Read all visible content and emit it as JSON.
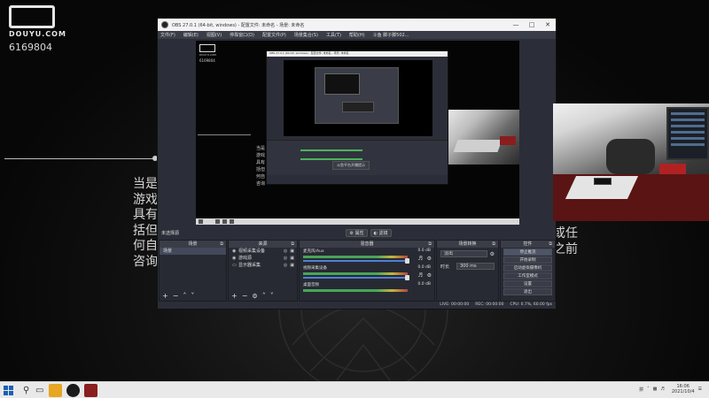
{
  "background": {
    "brand": "DOUYU.COM",
    "room_id": "6169804",
    "text_left": [
      "当是",
      "游戏",
      "具有",
      "括但",
      "何自",
      "咨询"
    ],
    "text_right": [
      "或任",
      "之前"
    ]
  },
  "obs": {
    "title": "OBS 27.0.1 (64-bit, windows) - 配置文件: 未命名 - 场景: 未命名",
    "menu": [
      "文件(F)",
      "编辑(E)",
      "视图(V)",
      "停靠窗口(D)",
      "配置文件(P)",
      "场景集合(S)",
      "工具(T)",
      "帮助(H)",
      "斗鱼 脚子脚502..."
    ],
    "preview_brand": "DOUYU.COM",
    "preview_room": "6169804",
    "preview_text": [
      "当是",
      "游戏",
      "具有",
      "括但",
      "何自",
      "咨询"
    ],
    "nested_popup": "斗鱼平台开播提示",
    "subbar": {
      "scene_label": "未选择源",
      "props": "属性",
      "filters": "滤镜"
    },
    "docks": {
      "scenes": {
        "title": "场景",
        "items": [
          "场景"
        ]
      },
      "sources": {
        "title": "来源",
        "items": [
          {
            "icon": "camera-icon",
            "label": "视频采集设备"
          },
          {
            "icon": "gamepad-icon",
            "label": "游戏源"
          },
          {
            "icon": "monitor-icon",
            "label": "显示器采集"
          }
        ]
      },
      "mixer": {
        "title": "混音器",
        "channels": [
          {
            "name": "麦克风/Aux",
            "db": "0.0 dB"
          },
          {
            "name": "视频采集设备",
            "db": "0.0 dB"
          },
          {
            "name": "桌面音频",
            "db": "0.0 dB"
          }
        ]
      },
      "transitions": {
        "title": "场景转换",
        "type": "淡出",
        "duration_label": "时长",
        "duration_value": "300 ms"
      },
      "controls": {
        "title": "控件",
        "buttons": [
          "停止推流",
          "开始录制",
          "启动虚拟摄像机",
          "工作室模式",
          "设置",
          "退出"
        ]
      }
    },
    "status": {
      "live": "LIVE: 00:00:00",
      "rec": "REC: 00:00:00",
      "cpu": "CPU: 0.7%, 60.00 fps"
    }
  },
  "taskbar": {
    "ime": "拼",
    "time": "16:06",
    "date": "2021/10/4",
    "colors": {
      "start": "#1b5fb5",
      "app1": "#e7a623",
      "app2": "#1a1a1a",
      "app3": "#8a1f1f"
    }
  }
}
